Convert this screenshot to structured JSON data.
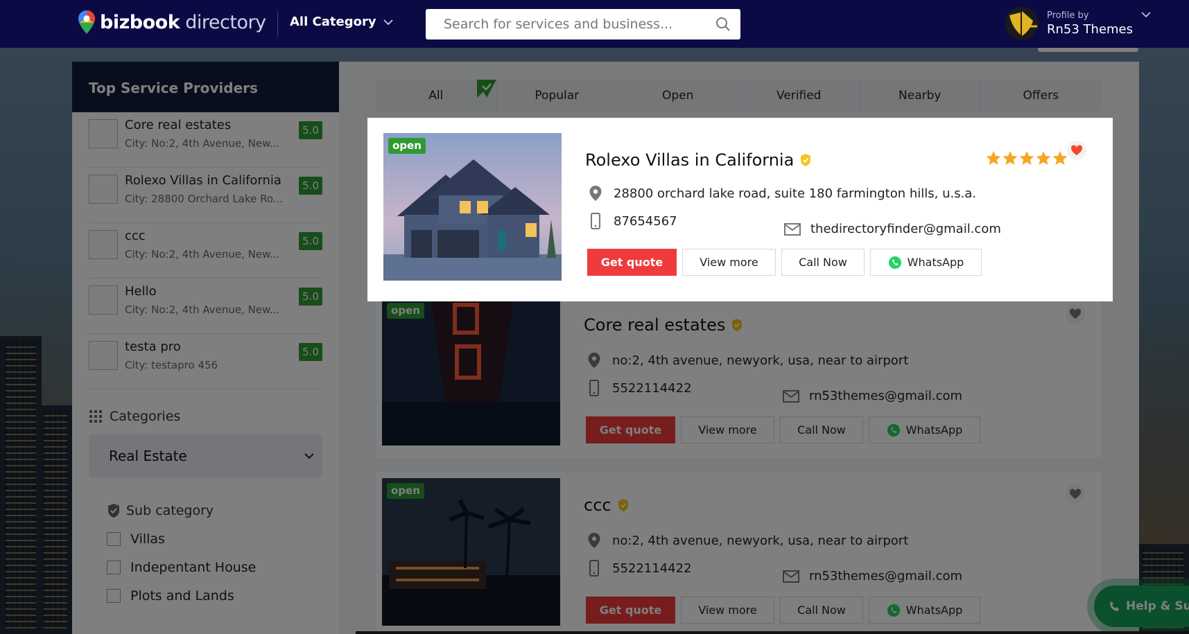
{
  "header": {
    "logo_bold": "bizbook",
    "logo_light": " directory",
    "category_label": "All Category",
    "search_placeholder": "Search for services and business...",
    "profile_small": "Profile by",
    "profile_name": "Rn53 Themes"
  },
  "sidebar": {
    "title": "Top Service Providers",
    "providers": [
      {
        "name": "Core real estates",
        "city": "City: No:2, 4th Avenue,  New...",
        "rating": "5.0"
      },
      {
        "name": "Rolexo Villas in California",
        "city": "City: 28800 Orchard Lake Ro...",
        "rating": "5.0"
      },
      {
        "name": "ccc",
        "city": "City: No:2, 4th Avenue,  New...",
        "rating": "5.0"
      },
      {
        "name": "Hello",
        "city": "City: No:2, 4th Avenue,  New...",
        "rating": "5.0"
      },
      {
        "name": "testa pro",
        "city": "City: testapro 456",
        "rating": "5.0"
      }
    ],
    "categories_label": "Categories",
    "selected_category": "Real Estate",
    "subcategory_label": "Sub category",
    "subcategories": [
      "Villas",
      "Indepentant House",
      "Plots and Lands"
    ]
  },
  "filters": [
    "All",
    "Popular",
    "Open",
    "Verified",
    "Nearby",
    "Offers"
  ],
  "listings": [
    {
      "badge": "open",
      "title": "Rolexo Villas in California",
      "address": "28800 orchard lake road, suite 180 farmington hills, u.s.a.",
      "phone": "87654567",
      "email": "thedirectoryfinder@gmail.com",
      "favorited": true
    },
    {
      "badge": "open",
      "title": "Core real estates",
      "address": "no:2, 4th avenue, newyork, usa, near to airport",
      "phone": "5522114422",
      "email": "rn53themes@gmail.com",
      "favorited": false
    },
    {
      "badge": "open",
      "title": "ccc",
      "address": "no:2, 4th avenue, newyork, usa, near to airport",
      "phone": "5522114422",
      "email": "rn53themes@gmail.com",
      "favorited": false
    }
  ],
  "buttons": {
    "quote": "Get quote",
    "view_more": "View more",
    "call_now": "Call Now",
    "whatsapp": "WhatsApp"
  },
  "help_label": "Help & Su",
  "colors": {
    "header": "#0b0a45",
    "accent_red": "#ef3b3b",
    "rating_green": "#2e9a34",
    "star": "#f5a623",
    "verified": "#f5c518"
  }
}
